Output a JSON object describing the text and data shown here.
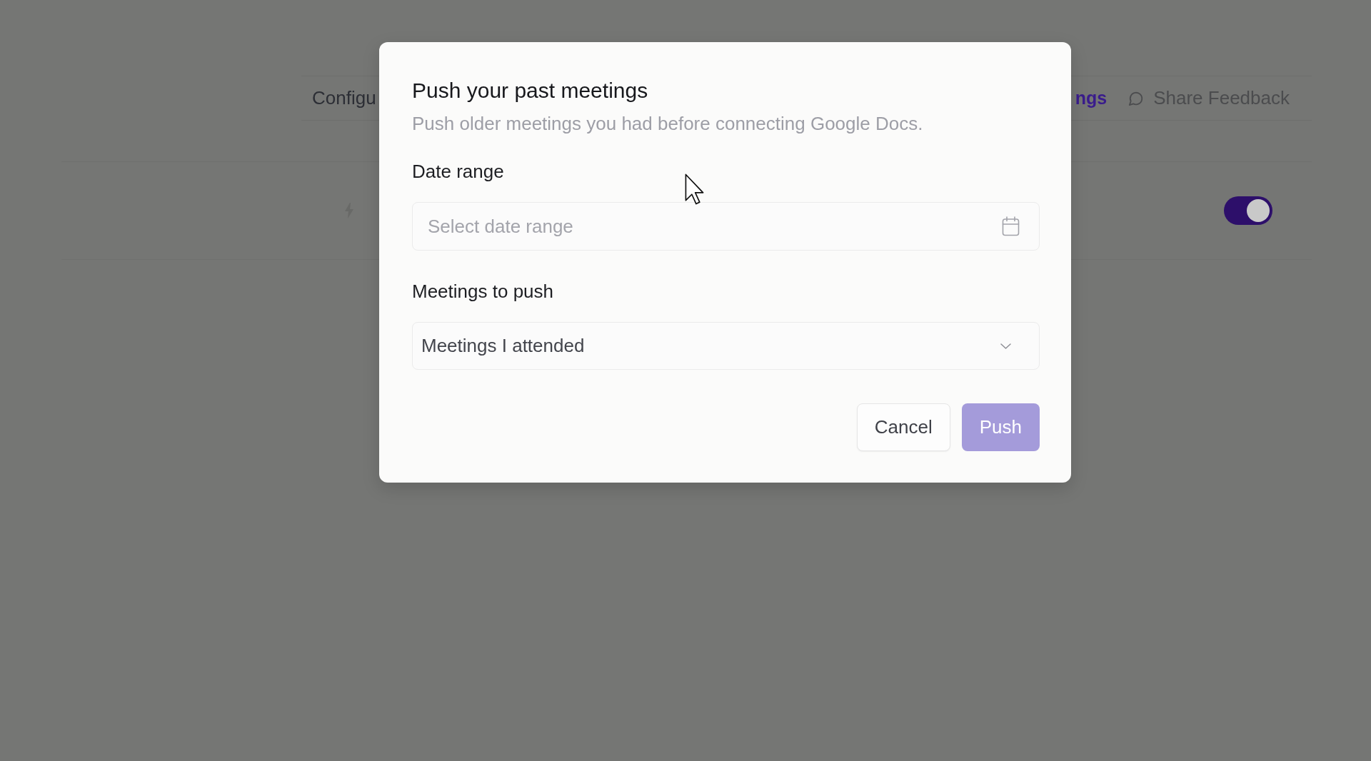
{
  "nav": {
    "items": [
      {
        "label": "Configu",
        "selected": false
      },
      {
        "label": "ngs",
        "selected": true
      }
    ],
    "feedback_link": "Share Feedback"
  },
  "settings_row": {
    "toggle": {
      "on": true
    }
  },
  "dialog": {
    "title": "Push your past meetings",
    "subtitle": "Push older meetings you had before connecting Google Docs.",
    "fields": [
      {
        "kind": "date",
        "label": "Date range",
        "placeholder": "Select date range"
      },
      {
        "kind": "select",
        "label": "Meetings to push",
        "value": "Meetings I attended"
      }
    ],
    "buttons": [
      {
        "label": "Cancel",
        "kind": "secondary",
        "disabled": false
      },
      {
        "label": "Push",
        "kind": "primary",
        "disabled": true
      }
    ]
  }
}
